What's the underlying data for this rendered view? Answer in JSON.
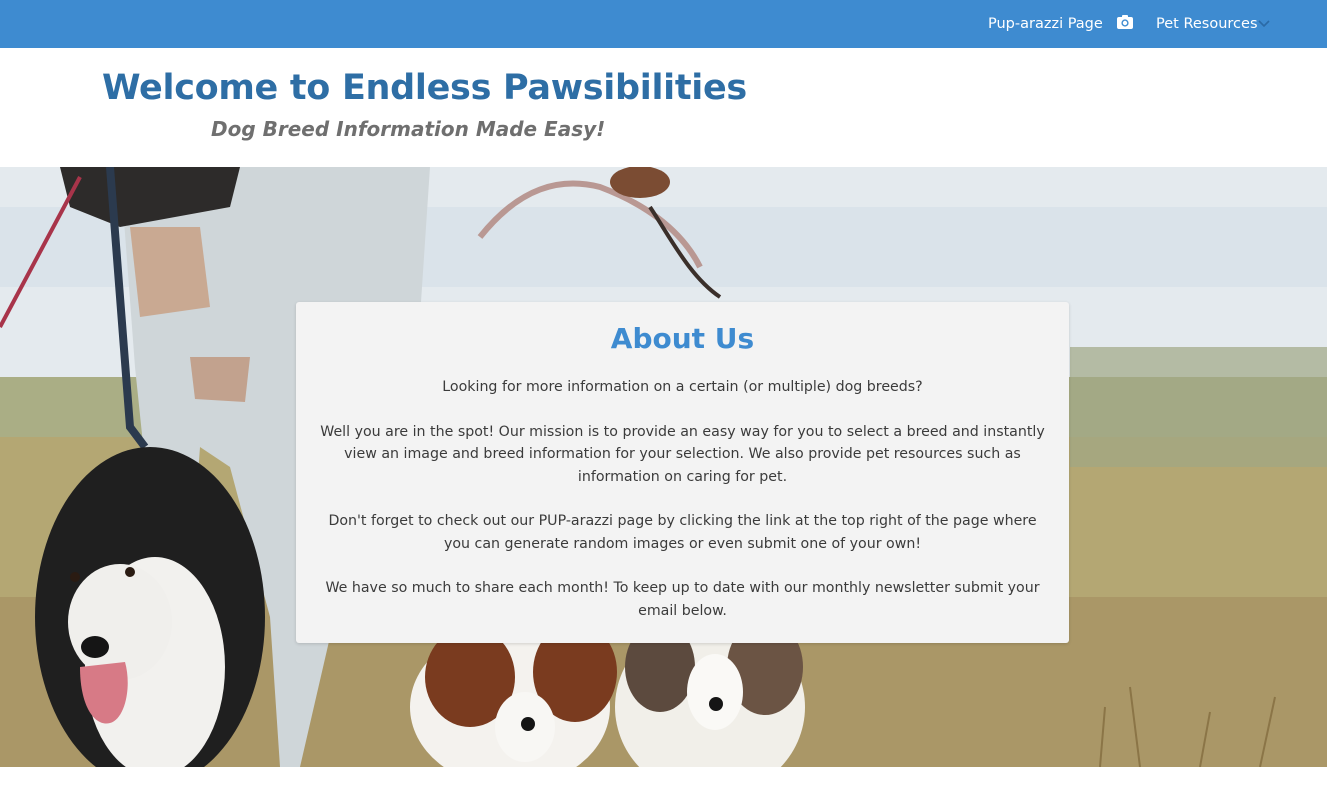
{
  "navbar": {
    "pup_link": "Pup-arazzi Page",
    "camera_icon": "camera-icon",
    "resources_label": "Pet Resources",
    "chevron_icon": "chevron-down-icon",
    "bg_color": "#3e8bd0"
  },
  "header": {
    "title": "Welcome to Endless Pawsibilities",
    "subtitle": "Dog Breed Information Made Easy!",
    "title_color": "#2e6ea5"
  },
  "about": {
    "heading": "About Us",
    "paragraphs": [
      "Looking for more information on a certain (or multiple) dog breeds?",
      "Well you are in the spot! Our mission is to provide an easy way for you to select a breed and instantly view an image and breed information for your selection. We also provide pet resources such as information on caring for pet.",
      "Don't forget to check out our PUP-arazzi page by clicking the link at the top right of the page where you can generate random images or even submit one of your own!",
      "We have so much to share each month! To keep up to date with our monthly newsletter submit your email below."
    ]
  }
}
